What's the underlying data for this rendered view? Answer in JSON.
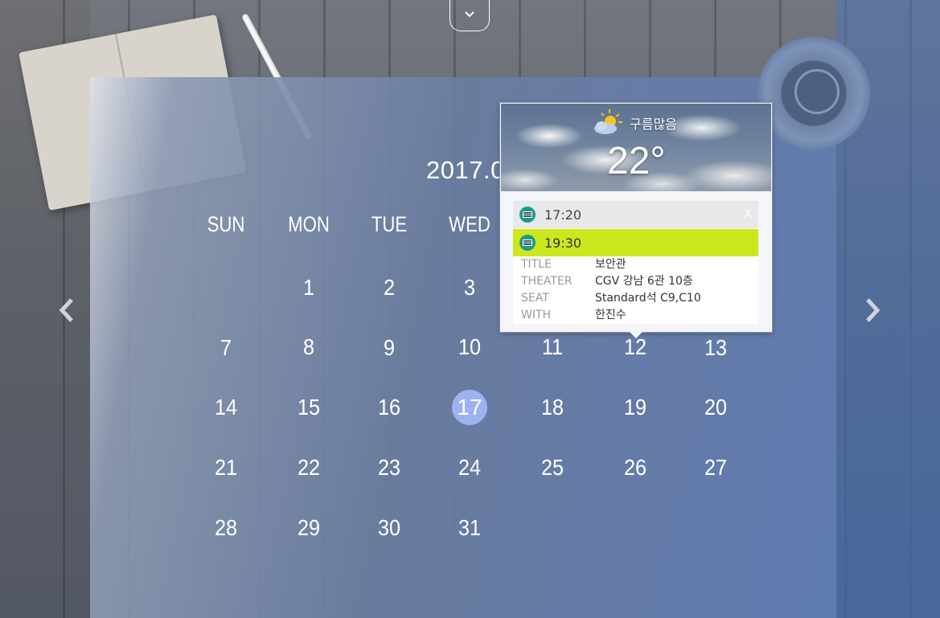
{
  "calendar": {
    "month_title": "2017.0",
    "weekdays": [
      "SUN",
      "MON",
      "TUE",
      "WED"
    ],
    "days": [
      "1",
      "2",
      "3",
      "7",
      "8",
      "9",
      "10",
      "11",
      "12",
      "13",
      "14",
      "15",
      "16",
      "17",
      "18",
      "19",
      "20",
      "21",
      "22",
      "23",
      "24",
      "25",
      "26",
      "27",
      "28",
      "29",
      "30",
      "31"
    ],
    "today": "17",
    "today_color": "#9db2f3"
  },
  "popup": {
    "weather": {
      "icon": "partly-cloudy-icon",
      "description": "구름많음",
      "temperature": "22°"
    },
    "events": [
      {
        "time": "17:20",
        "icon": "cinema-icon",
        "close_label": "X"
      },
      {
        "time": "19:30",
        "icon": "cinema-icon",
        "highlight_color": "#cce71b"
      }
    ],
    "detail": {
      "title_label": "TITLE",
      "title_value": "보안관",
      "theater_label": "THEATER",
      "theater_value": "CGV 강남 6관 10층",
      "seat_label": "SEAT",
      "seat_value": "Standard석 C9,C10",
      "with_label": "WITH",
      "with_value": "한진수"
    }
  },
  "navigation": {
    "prev_icon": "chevron-left-icon",
    "next_icon": "chevron-right-icon",
    "toggle_icon": "chevron-down-icon"
  }
}
